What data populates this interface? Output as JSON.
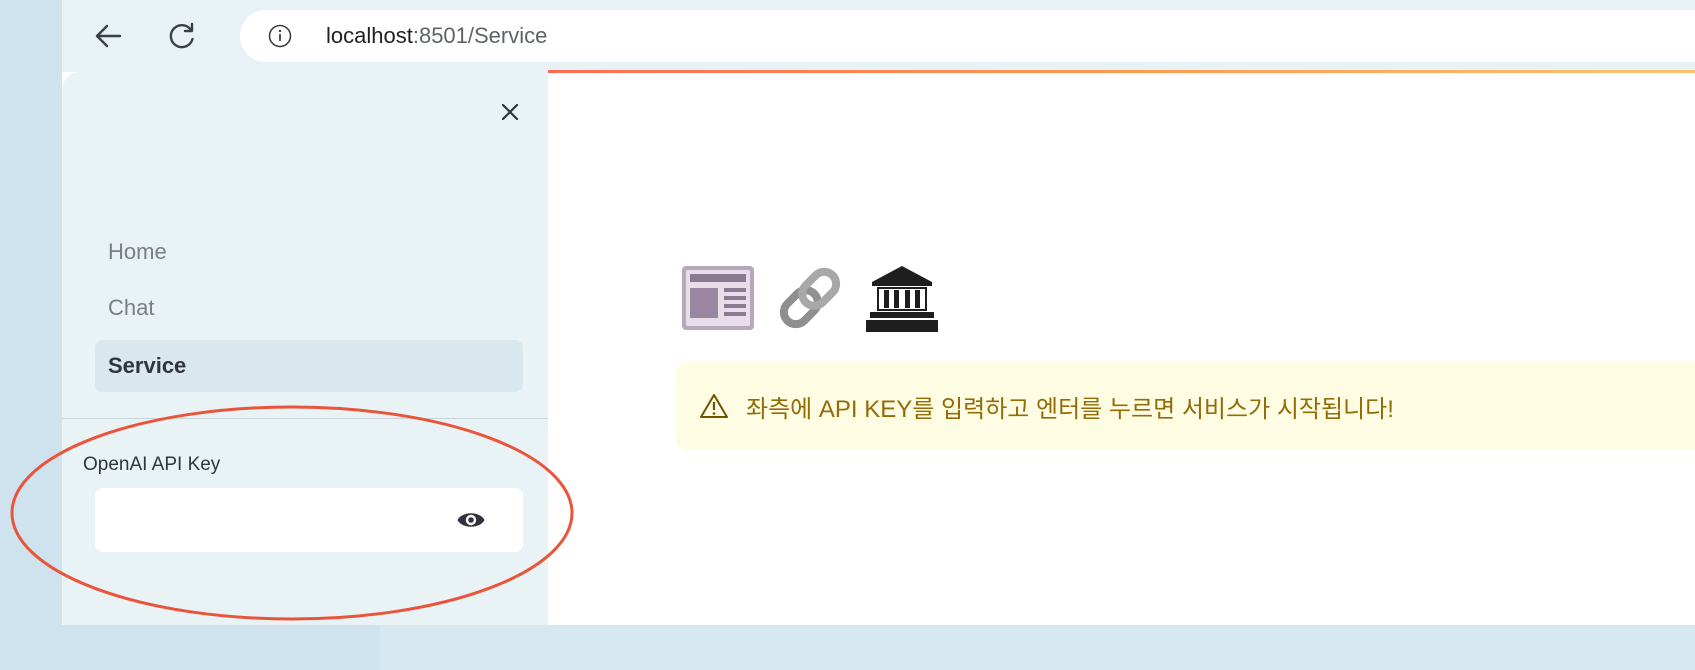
{
  "browser": {
    "url_host": "localhost",
    "url_rest": ":8501/Service",
    "back_label": "Back",
    "reload_label": "Reload"
  },
  "sidebar": {
    "nav": [
      {
        "label": "Home",
        "active": false
      },
      {
        "label": "Chat",
        "active": false
      },
      {
        "label": "Service",
        "active": true
      }
    ],
    "api_key_label": "OpenAI API Key",
    "api_key_value": ""
  },
  "main": {
    "emojis": [
      "newspaper-icon",
      "link-icon",
      "bank-icon"
    ],
    "warning_text": "좌측에 API KEY를 입력하고 엔터를 누르면 서비스가 시작됩니다!"
  },
  "colors": {
    "sidebar_bg": "#e9f2f5",
    "active_nav_bg": "#d8e8ed",
    "warning_bg": "#fffce4",
    "warning_text": "#926c05",
    "annotation": "#e8553a"
  }
}
